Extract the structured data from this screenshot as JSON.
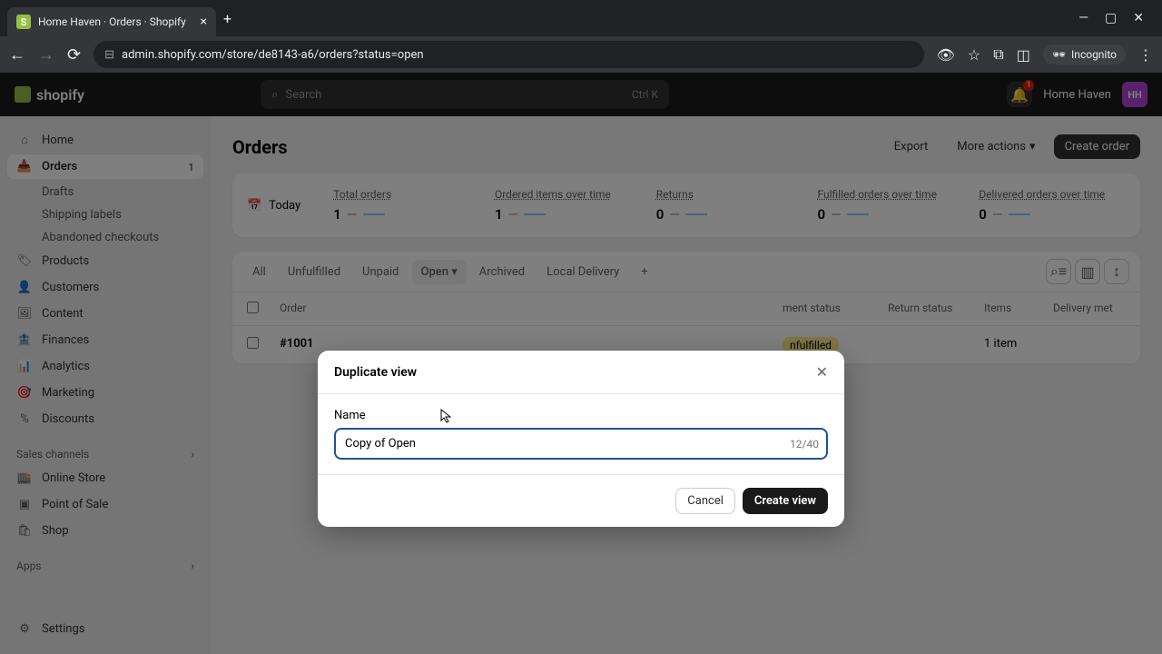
{
  "browser": {
    "tab_title": "Home Haven · Orders · Shopify",
    "url": "admin.shopify.com/store/de8143-a6/orders?status=open",
    "incognito": "Incognito"
  },
  "header": {
    "logo_text": "shopify",
    "search_placeholder": "Search",
    "search_shortcut": "Ctrl K",
    "notif_count": "1",
    "store_name": "Home Haven",
    "avatar_initials": "HH"
  },
  "sidebar": {
    "home": "Home",
    "orders": "Orders",
    "orders_count": "1",
    "drafts": "Drafts",
    "shipping_labels": "Shipping labels",
    "abandoned": "Abandoned checkouts",
    "products": "Products",
    "customers": "Customers",
    "content": "Content",
    "finances": "Finances",
    "analytics": "Analytics",
    "marketing": "Marketing",
    "discounts": "Discounts",
    "sales_channels": "Sales channels",
    "online_store": "Online Store",
    "point_of_sale": "Point of Sale",
    "shop": "Shop",
    "apps": "Apps",
    "settings": "Settings"
  },
  "page": {
    "title": "Orders",
    "export": "Export",
    "more_actions": "More actions",
    "create_order": "Create order"
  },
  "stats": {
    "period": "Today",
    "total_orders_label": "Total orders",
    "total_orders_value": "1",
    "ordered_items_label": "Ordered items over time",
    "ordered_items_value": "1",
    "returns_label": "Returns",
    "returns_value": "0",
    "fulfilled_label": "Fulfilled orders over time",
    "fulfilled_value": "0",
    "delivered_label": "Delivered orders over time",
    "delivered_value": "0"
  },
  "tabs": {
    "all": "All",
    "unfulfilled": "Unfulfilled",
    "unpaid": "Unpaid",
    "open": "Open",
    "archived": "Archived",
    "local_delivery": "Local Delivery"
  },
  "table": {
    "col_order": "Order",
    "col_fulfillment": "ment status",
    "col_return": "Return status",
    "col_items": "Items",
    "col_delivery": "Delivery met",
    "row_order": "#1001",
    "row_fulfillment": "nfulfilled",
    "row_items": "1 item"
  },
  "modal": {
    "title": "Duplicate view",
    "name_label": "Name",
    "name_value": "Copy of Open",
    "counter": "12/40",
    "cancel": "Cancel",
    "create": "Create view"
  }
}
